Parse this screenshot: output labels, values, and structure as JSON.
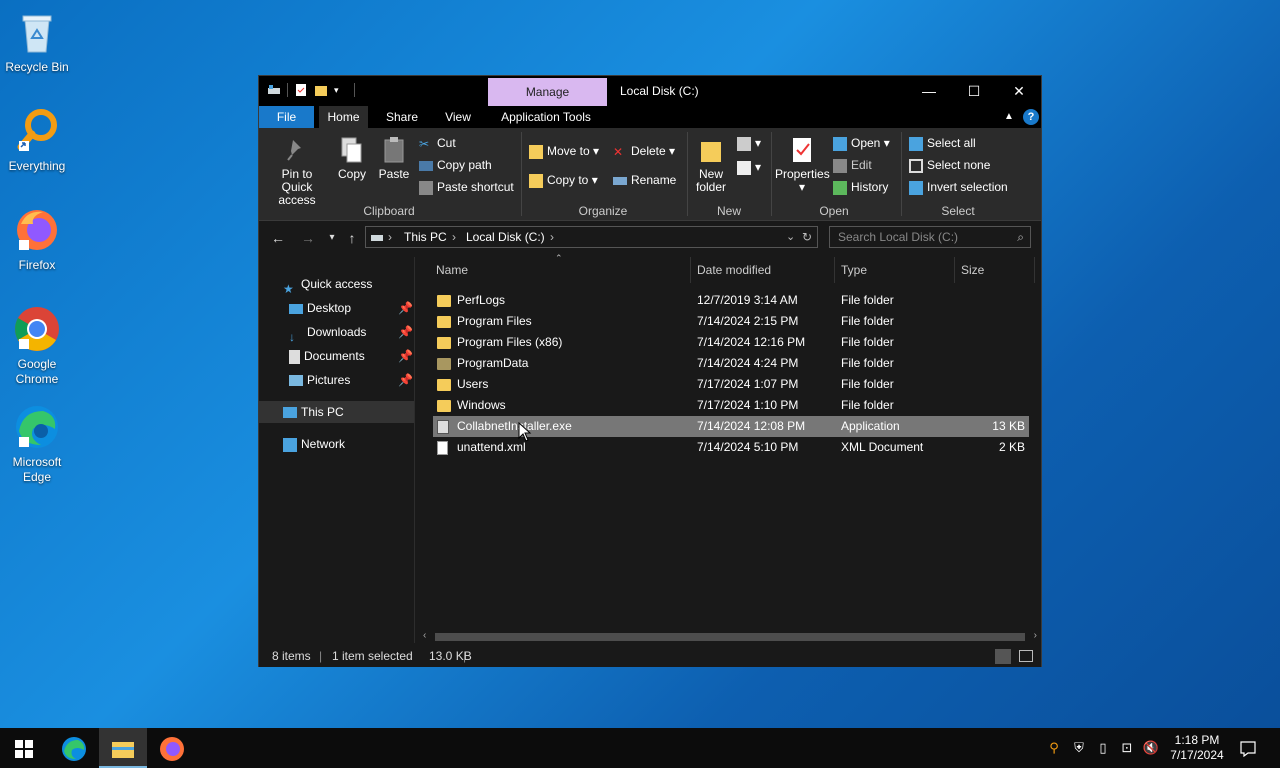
{
  "desktop": {
    "icons": [
      {
        "label": "Recycle Bin",
        "icon": "recycle-bin-icon"
      },
      {
        "label": "Everything",
        "icon": "everything-search-icon"
      },
      {
        "label": "Firefox",
        "icon": "firefox-icon"
      },
      {
        "label": "Google Chrome",
        "icon": "chrome-icon"
      },
      {
        "label": "Microsoft Edge",
        "icon": "edge-icon"
      }
    ]
  },
  "window": {
    "title": "Local Disk (C:)",
    "context_tab": "Manage",
    "controls": {
      "minimize": "—",
      "maximize": "☐",
      "close": "✕"
    }
  },
  "ribbon_tabs": {
    "file": "File",
    "home": "Home",
    "share": "Share",
    "view": "View",
    "app_tools": "Application Tools"
  },
  "ribbon": {
    "clipboard": {
      "label": "Clipboard",
      "pin": "Pin to Quick access",
      "copy": "Copy",
      "paste": "Paste",
      "cut": "Cut",
      "copy_path": "Copy path",
      "paste_shortcut": "Paste shortcut"
    },
    "organize": {
      "label": "Organize",
      "move_to": "Move to",
      "copy_to": "Copy to",
      "delete": "Delete",
      "rename": "Rename"
    },
    "new": {
      "label": "New",
      "new_folder": "New folder"
    },
    "open": {
      "label": "Open",
      "properties": "Properties",
      "open": "Open",
      "edit": "Edit",
      "history": "History"
    },
    "select": {
      "label": "Select",
      "select_all": "Select all",
      "select_none": "Select none",
      "invert": "Invert selection"
    }
  },
  "address": {
    "crumbs": [
      "This PC",
      "Local Disk (C:)"
    ],
    "search_placeholder": "Search Local Disk (C:)"
  },
  "nav": {
    "quick_access": "Quick access",
    "items": [
      {
        "label": "Desktop"
      },
      {
        "label": "Downloads"
      },
      {
        "label": "Documents"
      },
      {
        "label": "Pictures"
      }
    ],
    "this_pc": "This PC",
    "network": "Network"
  },
  "columns": {
    "name": "Name",
    "date": "Date modified",
    "type": "Type",
    "size": "Size"
  },
  "files": [
    {
      "name": "PerfLogs",
      "date": "12/7/2019 3:14 AM",
      "type": "File folder",
      "size": "",
      "kind": "folder"
    },
    {
      "name": "Program Files",
      "date": "7/14/2024 2:15 PM",
      "type": "File folder",
      "size": "",
      "kind": "folder"
    },
    {
      "name": "Program Files (x86)",
      "date": "7/14/2024 12:16 PM",
      "type": "File folder",
      "size": "",
      "kind": "folder"
    },
    {
      "name": "ProgramData",
      "date": "7/14/2024 4:24 PM",
      "type": "File folder",
      "size": "",
      "kind": "folder-hidden"
    },
    {
      "name": "Users",
      "date": "7/17/2024 1:07 PM",
      "type": "File folder",
      "size": "",
      "kind": "folder"
    },
    {
      "name": "Windows",
      "date": "7/17/2024 1:10 PM",
      "type": "File folder",
      "size": "",
      "kind": "folder"
    },
    {
      "name": "CollabnetInstaller.exe",
      "date": "7/14/2024 12:08 PM",
      "type": "Application",
      "size": "13 KB",
      "kind": "exe",
      "selected": true
    },
    {
      "name": "unattend.xml",
      "date": "7/14/2024 5:10 PM",
      "type": "XML Document",
      "size": "2 KB",
      "kind": "xml"
    }
  ],
  "status": {
    "count": "8 items",
    "selected": "1 item selected",
    "size": "13.0 KB"
  },
  "taskbar": {
    "time": "1:18 PM",
    "date": "7/17/2024"
  },
  "colors": {
    "file_tab": "#1979ca",
    "manage_tab": "#d9b8f0",
    "folder": "#f5cc5a",
    "selection": "#777777"
  }
}
